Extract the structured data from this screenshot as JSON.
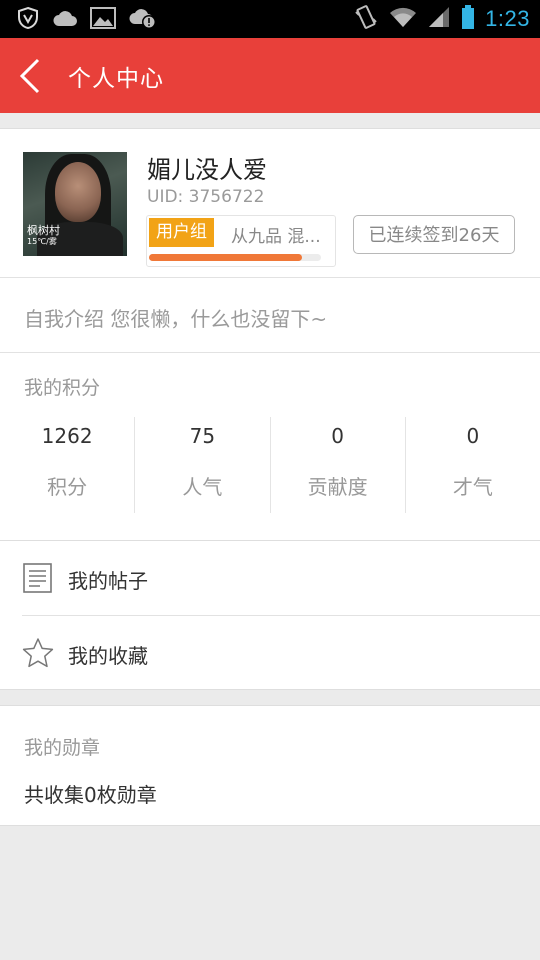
{
  "status_bar": {
    "time": "1:23",
    "icons_left": [
      "shield-v-icon",
      "cloud-icon",
      "image-icon",
      "cloud-alert-icon"
    ],
    "icons_right": [
      "vibrate-icon",
      "wifi-icon",
      "signal-icon",
      "battery-icon"
    ],
    "accent": "#33b5e5"
  },
  "header": {
    "title": "个人中心",
    "back_icon": "back-arrow-icon",
    "bg_color": "#e8403a"
  },
  "profile": {
    "username": "媚儿没人爱",
    "uid": "UID: 3756722",
    "avatar_overlay": {
      "city": "枫树村",
      "temp": "15℃/雾"
    },
    "group_badge": "用户组",
    "group_name": "从九品 混...",
    "group_badge_color": "#f2a316",
    "level_progress": 0.89,
    "progress_color": "#f07838",
    "checkin_label": "已连续签到26天",
    "intro": "自我介绍 您很懒，什么也没留下~"
  },
  "points": {
    "title": "我的积分",
    "items": [
      {
        "value": "1262",
        "label": "积分"
      },
      {
        "value": "75",
        "label": "人气"
      },
      {
        "value": "0",
        "label": "贡献度"
      },
      {
        "value": "0",
        "label": "才气"
      }
    ]
  },
  "menu": {
    "items": [
      {
        "label": "我的帖子",
        "icon": "document-icon"
      },
      {
        "label": "我的收藏",
        "icon": "star-icon"
      }
    ]
  },
  "medals": {
    "title": "我的勋章",
    "count_text": "共收集0枚勋章"
  }
}
